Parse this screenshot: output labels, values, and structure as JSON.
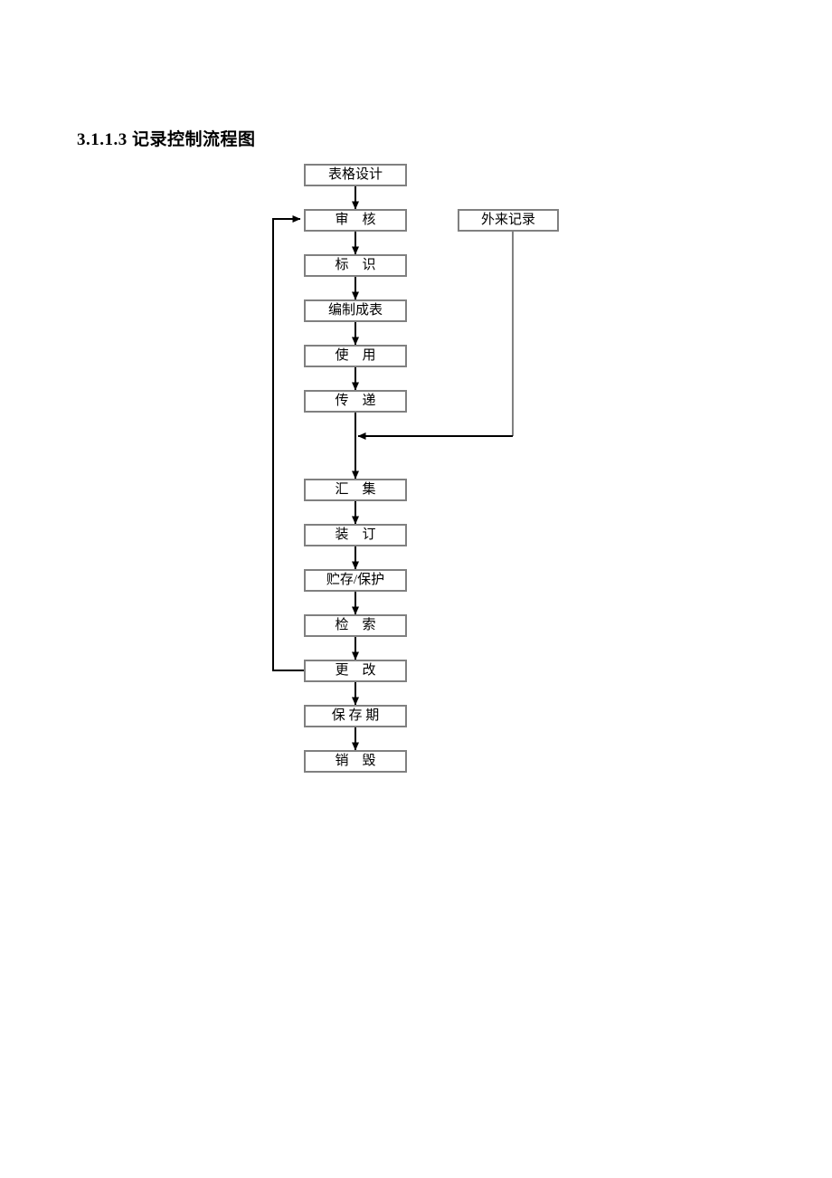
{
  "document": {
    "heading_number": "3.1.1.3",
    "heading_text": "记录控制流程图",
    "heading_full": "3.1.1.3 记录控制流程图"
  },
  "flowchart": {
    "type": "flowchart",
    "orientation": "top-to-bottom",
    "box_border_color": "#808080",
    "connector_color": "#000000",
    "main_nodes": [
      {
        "id": "form-design",
        "label": "表格设计"
      },
      {
        "id": "review",
        "label": "审　核"
      },
      {
        "id": "identify",
        "label": "标　识"
      },
      {
        "id": "compile-table",
        "label": "编制成表"
      },
      {
        "id": "use",
        "label": "使　用"
      },
      {
        "id": "transfer",
        "label": "传　递"
      },
      {
        "id": "collect",
        "label": "汇　集"
      },
      {
        "id": "binding",
        "label": "装　订"
      },
      {
        "id": "store-protect",
        "label": "贮存/保护"
      },
      {
        "id": "retrieve",
        "label": "检　索"
      },
      {
        "id": "modify",
        "label": "更　改"
      },
      {
        "id": "retention",
        "label": "保 存 期"
      },
      {
        "id": "destroy",
        "label": "销　毁"
      }
    ],
    "side_nodes": [
      {
        "id": "external-record",
        "label": "外来记录"
      }
    ],
    "edges": [
      {
        "from": "form-design",
        "to": "review",
        "style": "arrow-down"
      },
      {
        "from": "review",
        "to": "identify",
        "style": "arrow-down"
      },
      {
        "from": "identify",
        "to": "compile-table",
        "style": "arrow-down"
      },
      {
        "from": "compile-table",
        "to": "use",
        "style": "arrow-down"
      },
      {
        "from": "use",
        "to": "transfer",
        "style": "arrow-down"
      },
      {
        "from": "transfer",
        "to": "collect",
        "style": "arrow-down"
      },
      {
        "from": "collect",
        "to": "binding",
        "style": "arrow-down"
      },
      {
        "from": "binding",
        "to": "store-protect",
        "style": "arrow-down"
      },
      {
        "from": "store-protect",
        "to": "retrieve",
        "style": "arrow-down"
      },
      {
        "from": "retrieve",
        "to": "modify",
        "style": "arrow-down"
      },
      {
        "from": "modify",
        "to": "retention",
        "style": "arrow-down"
      },
      {
        "from": "retention",
        "to": "destroy",
        "style": "arrow-down"
      },
      {
        "from": "external-record",
        "to": "transfer-collect-link",
        "style": "elbow-arrow-left"
      },
      {
        "from": "modify",
        "to": "review",
        "style": "feedback-loop-left"
      }
    ]
  }
}
